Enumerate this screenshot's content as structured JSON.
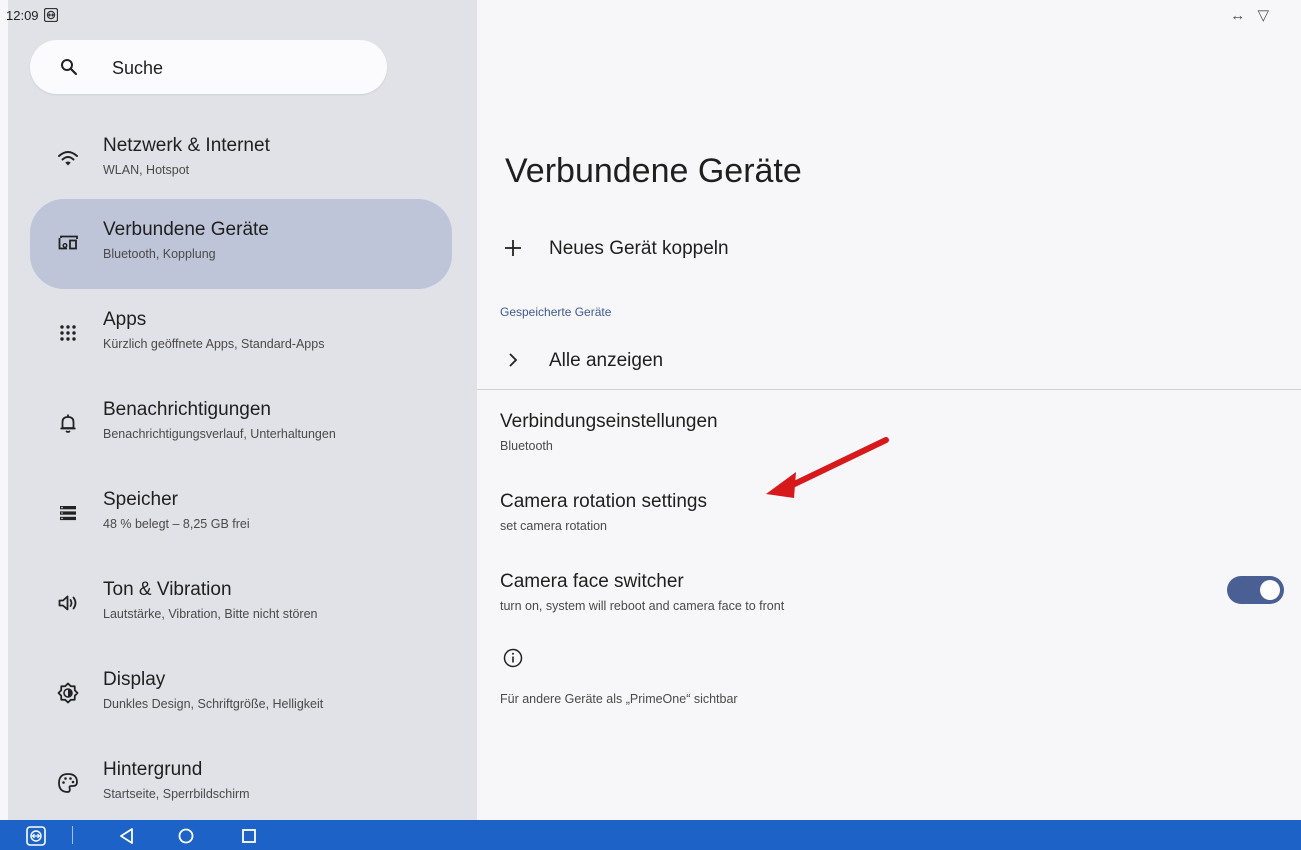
{
  "status_bar": {
    "time": "12:09",
    "right_icons": "↔ ▽"
  },
  "sidebar": {
    "search_placeholder": "Suche",
    "items": [
      {
        "title": "Netzwerk & Internet",
        "subtitle": "WLAN, Hotspot",
        "icon": "wifi-icon",
        "selected": false
      },
      {
        "title": "Verbundene Geräte",
        "subtitle": "Bluetooth, Kopplung",
        "icon": "connected-devices-icon",
        "selected": true
      },
      {
        "title": "Apps",
        "subtitle": "Kürzlich geöffnete Apps, Standard-Apps",
        "icon": "apps-grid-icon",
        "selected": false
      },
      {
        "title": "Benachrichtigungen",
        "subtitle": "Benachrichtigungsverlauf, Unterhaltungen",
        "icon": "bell-icon",
        "selected": false
      },
      {
        "title": "Speicher",
        "subtitle": "48 % belegt – 8,25 GB frei",
        "icon": "storage-icon",
        "selected": false
      },
      {
        "title": "Ton & Vibration",
        "subtitle": "Lautstärke, Vibration, Bitte nicht stören",
        "icon": "volume-icon",
        "selected": false
      },
      {
        "title": "Display",
        "subtitle": "Dunkles Design, Schriftgröße, Helligkeit",
        "icon": "brightness-icon",
        "selected": false
      },
      {
        "title": "Hintergrund",
        "subtitle": "Startseite, Sperrbildschirm",
        "icon": "palette-icon",
        "selected": false
      }
    ]
  },
  "main": {
    "title": "Verbundene Geräte",
    "pair_new_label": "Neues Gerät koppeln",
    "saved_section_header": "Gespeicherte Geräte",
    "show_all_label": "Alle anzeigen",
    "prefs": [
      {
        "title": "Verbindungseinstellungen",
        "subtitle": "Bluetooth"
      },
      {
        "title": "Camera rotation settings",
        "subtitle": "set camera rotation"
      },
      {
        "title": "Camera face switcher",
        "subtitle": "turn on, system will reboot and camera face to front"
      }
    ],
    "face_switcher_on": true,
    "visibility_text": "Für andere Geräte als „PrimeOne“ sichtbar"
  },
  "colors": {
    "accent": "#4a5f94",
    "selected_bg": "#bfc5d9",
    "nav_bar": "#1d62c6",
    "annotation_arrow": "#d7191c"
  }
}
